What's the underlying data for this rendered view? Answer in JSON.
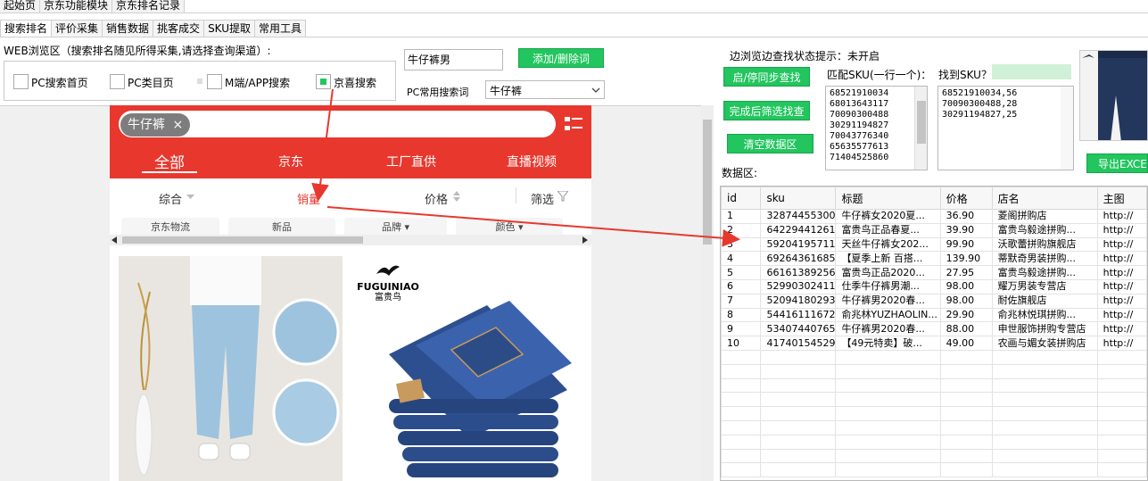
{
  "top_tabs": [
    "起始页",
    "京东功能模块",
    "京东排名记录"
  ],
  "sub_tabs": [
    "搜索排名",
    "评价采集",
    "销售数据",
    "挑客成交",
    "SKU提取",
    "常用工具"
  ],
  "left": {
    "web_area_label": "WEB浏览区（搜索排名随见所得采集,请选择查询渠道）:",
    "keyword_input": "牛仔裤男",
    "add_delete_button": "添加/删除词",
    "channels": [
      {
        "label": "PC搜索首页",
        "checked": false
      },
      {
        "label": "PC类目页",
        "checked": false
      },
      {
        "label": "M端/APP搜索",
        "checked": false
      },
      {
        "label": "京喜搜索",
        "checked": true
      }
    ],
    "common_search_label": "PC常用搜索词",
    "common_search_value": "牛仔裤"
  },
  "webview": {
    "search_chip": "牛仔裤",
    "close_symbol": "×",
    "nav_tabs": [
      "全部",
      "京东",
      "工厂直供",
      "直播视频"
    ],
    "sort_items": [
      "综合",
      "销量",
      "价格",
      "筛选"
    ],
    "filters": [
      "京东物流",
      "新品",
      "品牌",
      "颜色"
    ],
    "product2_brand": "FUGUINIAO",
    "product2_brand_cn": "富贵鸟"
  },
  "right": {
    "status_label": "边浏览边查找状态提示：未开启",
    "sync_button": "启/停同步查找",
    "filter_button": "完成后筛选找查",
    "clear_button": "清空数据区",
    "match_sku_label": "匹配SKU(一行一个)：",
    "found_sku_label": "找到SKU？",
    "match_skus": [
      "68521910034",
      "68013643117",
      "70090300488",
      "30291194827",
      "70043776340",
      "65635577613",
      "71404525860"
    ],
    "found_skus": [
      "68521910034,56",
      "70090300488,28",
      "30291194827,25"
    ],
    "data_area_label": "数据区:",
    "export_button": "导出EXCEL",
    "columns": [
      "id",
      "sku",
      "标题",
      "价格",
      "店名",
      "主图"
    ],
    "rows": [
      [
        "1",
        "32874455300",
        "牛仔裤女2020夏...",
        "36.90",
        "菱阁拼购店",
        "http://"
      ],
      [
        "2",
        "64229441261",
        "富贵鸟正品春夏...",
        "39.90",
        "富贵鸟毅途拼购...",
        "http://"
      ],
      [
        "3",
        "59204195711",
        "天丝牛仔裤女202...",
        "99.90",
        "沃歌蕾拼购旗舰店",
        "http://"
      ],
      [
        "4",
        "69264361685",
        "【夏季上新 百搭...",
        "139.90",
        "蒂默奇男装拼购...",
        "http://"
      ],
      [
        "5",
        "66161389256",
        "富贵鸟正品2020...",
        "27.95",
        "富贵鸟毅途拼购...",
        "http://"
      ],
      [
        "6",
        "52990302411",
        "仕季牛仔裤男潮...",
        "98.00",
        "耀万男装专营店",
        "http://"
      ],
      [
        "7",
        "52094180293",
        "牛仔裤男2020春...",
        "98.00",
        "耐佐旗舰店",
        "http://"
      ],
      [
        "8",
        "54416111672",
        "俞兆林YUZHAOLIN...",
        "29.90",
        "俞兆林悦琪拼购...",
        "http://"
      ],
      [
        "9",
        "53407440765",
        "牛仔裤男2020春...",
        "88.00",
        "申世服饰拼购专营店",
        "http://"
      ],
      [
        "10",
        "41740154529",
        "【49元特卖】破...",
        "49.00",
        "农画与媚女装拼购店",
        "http://"
      ]
    ]
  }
}
